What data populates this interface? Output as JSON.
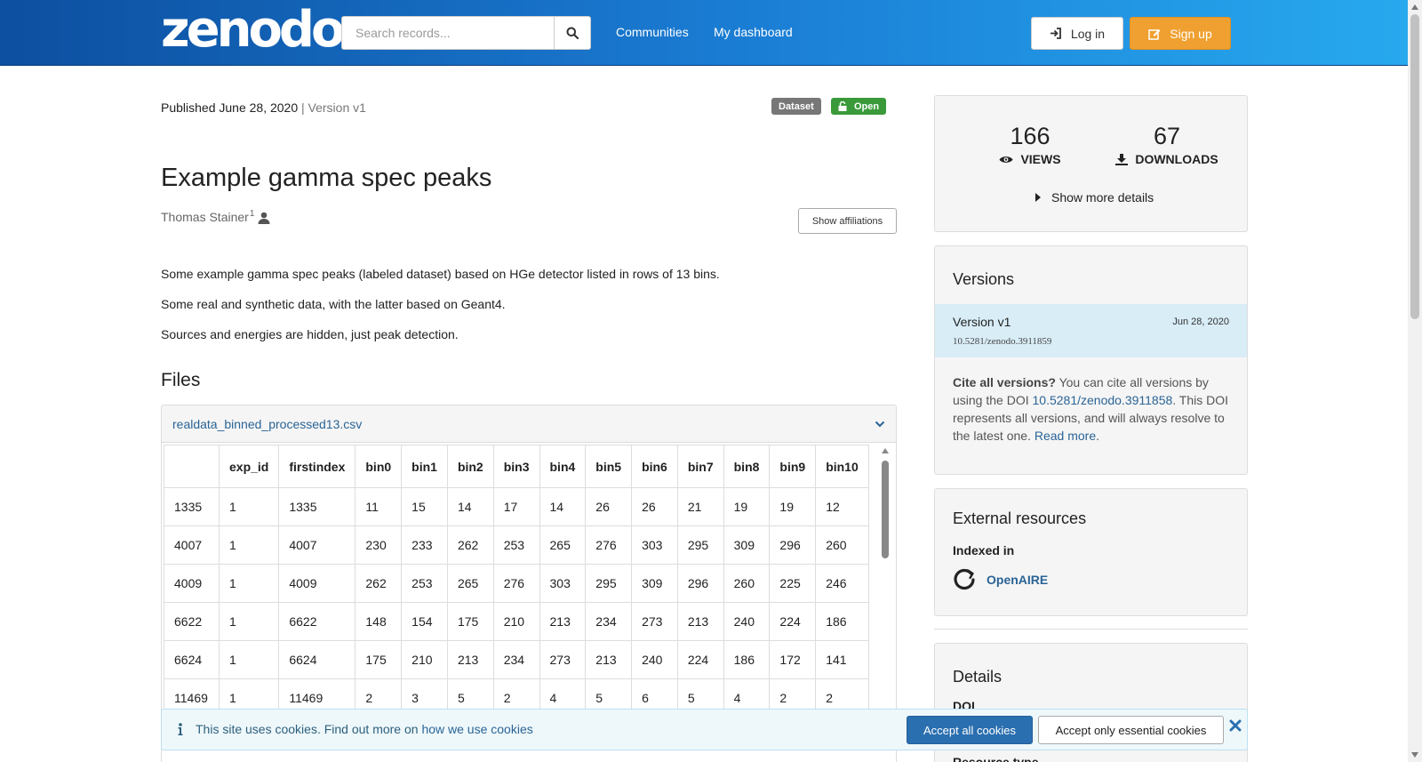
{
  "header": {
    "logo": "zenodo",
    "search_placeholder": "Search records...",
    "nav": [
      "Communities",
      "My dashboard"
    ],
    "login_label": "Log in",
    "signup_label": "Sign up",
    "signup_color": "#f0a030"
  },
  "record": {
    "published_label": "Published June 28, 2020",
    "version_label": "| Version v1",
    "badges": [
      "Dataset",
      "Open"
    ],
    "title": "Example gamma spec peaks",
    "author": "Thomas Stainer",
    "author_sup": "1",
    "affiliations_button": "Show affiliations",
    "description": [
      "Some example gamma spec peaks (labeled dataset) based on HGe detector listed in rows of 13 bins.",
      "Some real and synthetic data, with the latter based on Geant4.",
      "Sources and energies are hidden, just peak detection."
    ]
  },
  "files": {
    "heading": "Files",
    "file_name": "realdata_binned_processed13.csv",
    "columns": [
      "",
      "exp_id",
      "firstindex",
      "bin0",
      "bin1",
      "bin2",
      "bin3",
      "bin4",
      "bin5",
      "bin6",
      "bin7",
      "bin8",
      "bin9",
      "bin10"
    ],
    "rows": [
      [
        "1335",
        "1",
        "1335",
        "11",
        "15",
        "14",
        "17",
        "14",
        "26",
        "26",
        "21",
        "19",
        "19",
        "12"
      ],
      [
        "4007",
        "1",
        "4007",
        "230",
        "233",
        "262",
        "253",
        "265",
        "276",
        "303",
        "295",
        "309",
        "296",
        "260"
      ],
      [
        "4009",
        "1",
        "4009",
        "262",
        "253",
        "265",
        "276",
        "303",
        "295",
        "309",
        "296",
        "260",
        "225",
        "246"
      ],
      [
        "6622",
        "1",
        "6622",
        "148",
        "154",
        "175",
        "210",
        "213",
        "234",
        "273",
        "213",
        "240",
        "224",
        "186"
      ],
      [
        "6624",
        "1",
        "6624",
        "175",
        "210",
        "213",
        "234",
        "273",
        "213",
        "240",
        "224",
        "186",
        "172",
        "141"
      ],
      [
        "11469",
        "1",
        "11469",
        "2",
        "3",
        "5",
        "2",
        "4",
        "5",
        "6",
        "5",
        "4",
        "2",
        "2"
      ]
    ]
  },
  "stats": {
    "views": "166",
    "views_label": "VIEWS",
    "downloads": "67",
    "downloads_label": "DOWNLOADS",
    "more_details": "Show more details"
  },
  "versions": {
    "title": "Versions",
    "current_name": "Version v1",
    "current_date": "Jun 28, 2020",
    "current_doi": "10.5281/zenodo.3911859",
    "cite_bold": "Cite all versions?",
    "cite_text_1": " You can cite all versions by using the DOI ",
    "cite_doi": "10.5281/zenodo.3911858",
    "cite_text_2": ". This DOI represents all versions, and will always resolve to the latest one. ",
    "read_more": "Read more",
    "read_more_suffix": "."
  },
  "external": {
    "title": "External resources",
    "indexed_in": "Indexed in",
    "openaire": "OpenAIRE"
  },
  "details": {
    "title": "Details",
    "doi_label": "DOI",
    "resource_type_label": "Resource type"
  },
  "cookie": {
    "text": "This site uses cookies. Find out more on ",
    "link": "how we use cookies",
    "accept_all": "Accept all cookies",
    "accept_essential": "Accept only essential cookies"
  }
}
